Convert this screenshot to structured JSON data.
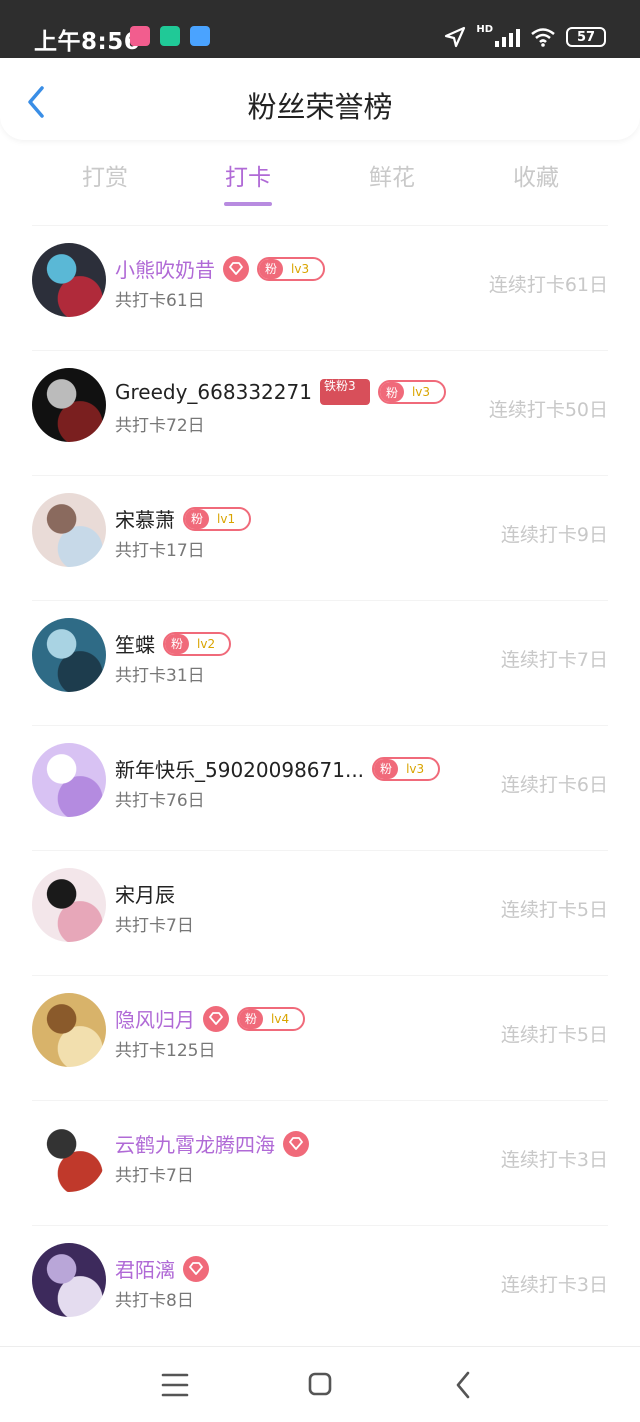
{
  "status_bar": {
    "time": "上午8:56",
    "battery": "57",
    "network": "HD"
  },
  "header": {
    "title": "粉丝荣誉榜",
    "back_icon": "chevron-left-icon"
  },
  "tabs": [
    {
      "label": "打赏",
      "active": false
    },
    {
      "label": "打卡",
      "active": true
    },
    {
      "label": "鲜花",
      "active": false
    },
    {
      "label": "收藏",
      "active": false
    }
  ],
  "fans": [
    {
      "name": "小熊吹奶昔",
      "vip": true,
      "heart": true,
      "fan_badge": {
        "label": "粉",
        "level": "lv3"
      },
      "iron_badge": null,
      "total": "共打卡61日",
      "streak": "连续打卡61日",
      "avatar_colors": [
        "#2c2f3a",
        "#5ab8d6",
        "#b02a3a"
      ]
    },
    {
      "name": "Greedy_668332271",
      "vip": false,
      "heart": false,
      "fan_badge": {
        "label": "粉",
        "level": "lv3"
      },
      "iron_badge": "铁粉3",
      "total": "共打卡72日",
      "streak": "连续打卡50日",
      "avatar_colors": [
        "#111111",
        "#bbbbbb",
        "#7a1f1f"
      ]
    },
    {
      "name": "宋慕萧",
      "vip": false,
      "heart": false,
      "fan_badge": {
        "label": "粉",
        "level": "lv1"
      },
      "iron_badge": null,
      "total": "共打卡17日",
      "streak": "连续打卡9日",
      "avatar_colors": [
        "#e9dbd7",
        "#8a6a5e",
        "#c7d9e8"
      ]
    },
    {
      "name": "笙蝶",
      "vip": false,
      "heart": false,
      "fan_badge": {
        "label": "粉",
        "level": "lv2"
      },
      "iron_badge": null,
      "total": "共打卡31日",
      "streak": "连续打卡7日",
      "avatar_colors": [
        "#2f6b86",
        "#a9d3e3",
        "#1d3c4d"
      ]
    },
    {
      "name": "新年快乐_59020098671...",
      "vip": false,
      "heart": false,
      "fan_badge": {
        "label": "粉",
        "level": "lv3"
      },
      "iron_badge": null,
      "total": "共打卡76日",
      "streak": "连续打卡6日",
      "avatar_colors": [
        "#d8c2f3",
        "#ffffff",
        "#b48be0"
      ]
    },
    {
      "name": "宋月辰",
      "vip": false,
      "heart": false,
      "fan_badge": null,
      "iron_badge": null,
      "total": "共打卡7日",
      "streak": "连续打卡5日",
      "avatar_colors": [
        "#f3e6ea",
        "#1a1a1a",
        "#e7a7b9"
      ]
    },
    {
      "name": "隐风归月",
      "vip": true,
      "heart": true,
      "fan_badge": {
        "label": "粉",
        "level": "lv4"
      },
      "iron_badge": null,
      "total": "共打卡125日",
      "streak": "连续打卡5日",
      "avatar_colors": [
        "#d8b36a",
        "#8a5a2b",
        "#f2dfae"
      ]
    },
    {
      "name": "云鹤九霄龙腾四海",
      "vip": true,
      "heart": true,
      "fan_badge": null,
      "iron_badge": null,
      "total": "共打卡7日",
      "streak": "连续打卡3日",
      "avatar_colors": [
        "#ffffff",
        "#333333",
        "#c0392b"
      ]
    },
    {
      "name": "君陌漓",
      "vip": true,
      "heart": true,
      "fan_badge": null,
      "iron_badge": null,
      "total": "共打卡8日",
      "streak": "连续打卡3日",
      "avatar_colors": [
        "#3d2a5c",
        "#b9a6d8",
        "#e4dcef"
      ]
    }
  ],
  "nav": {
    "menu_icon": "menu-icon",
    "home_icon": "home-square-icon",
    "back_icon": "back-chevron-icon"
  },
  "colors": {
    "accent": "#b06ad6",
    "badge": "#f06a7a",
    "muted": "#c8c8c8"
  }
}
